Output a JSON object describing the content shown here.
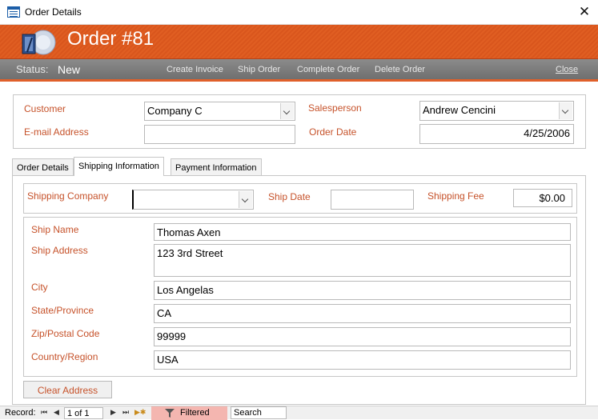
{
  "window": {
    "title": "Order Details",
    "close_glyph": "✕"
  },
  "header": {
    "order_title": "Order #81"
  },
  "statusbar": {
    "status_label": "Status:",
    "status_value": "New",
    "buttons": {
      "create_invoice": "Create Invoice",
      "ship_order": "Ship Order",
      "complete_order": "Complete Order",
      "delete_order": "Delete Order",
      "close": "Close"
    }
  },
  "order": {
    "customer_label": "Customer",
    "customer_value": "Company C",
    "email_label": "E-mail Address",
    "email_value": "",
    "salesperson_label": "Salesperson",
    "salesperson_value": "Andrew Cencini",
    "order_date_label": "Order Date",
    "order_date_value": "4/25/2006"
  },
  "tabs": [
    {
      "label": "Order Details"
    },
    {
      "label": "Shipping Information"
    },
    {
      "label": "Payment Information"
    }
  ],
  "shipping": {
    "company_label": "Shipping Company",
    "company_value": "",
    "ship_date_label": "Ship Date",
    "ship_date_value": "",
    "fee_label": "Shipping Fee",
    "fee_value": "$0.00",
    "ship_name_label": "Ship Name",
    "ship_name_value": "Thomas Axen",
    "address_label": "Ship Address",
    "address_value": "123 3rd Street",
    "city_label": "City",
    "city_value": "Los Angelas",
    "state_label": "State/Province",
    "state_value": "CA",
    "zip_label": "Zip/Postal Code",
    "zip_value": "99999",
    "country_label": "Country/Region",
    "country_value": "USA",
    "clear_button": "Clear Address"
  },
  "record_nav": {
    "label": "Record:",
    "position": "1 of 1",
    "filtered_label": "Filtered",
    "search_placeholder": "Search",
    "first": "⏮",
    "prev": "◀",
    "next": "▶",
    "last": "⏭",
    "new": "▶✱"
  },
  "colors": {
    "accent": "#e05e22",
    "label": "#c6522a"
  }
}
